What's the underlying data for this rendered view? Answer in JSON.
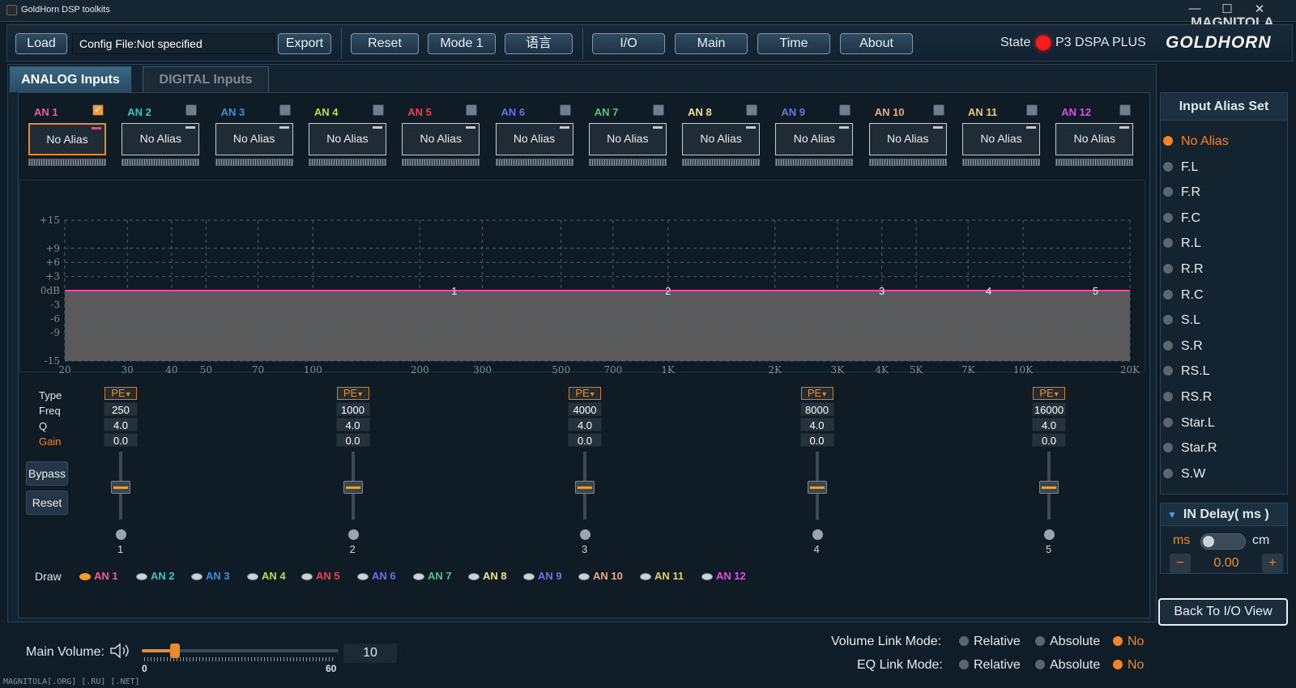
{
  "window": {
    "title": "GoldHorn DSP toolkits",
    "watermark": "MAGNITOLA",
    "footer_watermark": "MAGNITOLA[.ORG] [.RU] [.NET]"
  },
  "toolbar": {
    "load": "Load",
    "config_file": "Config File:Not specified",
    "export": "Export",
    "reset": "Reset",
    "mode": "Mode 1",
    "language": "语言",
    "io": "I/O",
    "main": "Main",
    "time": "Time",
    "about": "About",
    "state_label": "State",
    "state_color": "#ff1a1a",
    "device": "P3 DSPA PLUS",
    "brand": "GOLDHORN"
  },
  "tabs": [
    {
      "label": "ANALOG Inputs",
      "active": true
    },
    {
      "label": "DIGITAL Inputs",
      "active": false
    }
  ],
  "channels": [
    {
      "label": "AN 1",
      "color": "#f05a9c",
      "checked": true,
      "alias": "No Alias"
    },
    {
      "label": "AN 2",
      "color": "#39c7c9",
      "checked": false,
      "alias": "No Alias"
    },
    {
      "label": "AN 3",
      "color": "#3d8ee0",
      "checked": false,
      "alias": "No Alias"
    },
    {
      "label": "AN 4",
      "color": "#b7df4c",
      "checked": false,
      "alias": "No Alias"
    },
    {
      "label": "AN 5",
      "color": "#ef3f58",
      "checked": false,
      "alias": "No Alias"
    },
    {
      "label": "AN 6",
      "color": "#6a6cf2",
      "checked": false,
      "alias": "No Alias"
    },
    {
      "label": "AN 7",
      "color": "#52c67a",
      "checked": false,
      "alias": "No Alias"
    },
    {
      "label": "AN 8",
      "color": "#f2e38a",
      "checked": false,
      "alias": "No Alias"
    },
    {
      "label": "AN 9",
      "color": "#6b73e8",
      "checked": false,
      "alias": "No Alias"
    },
    {
      "label": "AN 10",
      "color": "#eea684",
      "checked": false,
      "alias": "No Alias"
    },
    {
      "label": "AN 11",
      "color": "#e6cc6a",
      "checked": false,
      "alias": "No Alias"
    },
    {
      "label": "AN 12",
      "color": "#e04ce6",
      "checked": false,
      "alias": "No Alias"
    }
  ],
  "graph": {
    "y_ticks": [
      "+15",
      "+9",
      "+6",
      "+3",
      "0dB",
      "-3",
      "-6",
      "-9",
      "-15"
    ],
    "x_ticks": [
      "20",
      "30",
      "40",
      "50",
      "70",
      "100",
      "200",
      "300",
      "500",
      "700",
      "1K",
      "2K",
      "3K",
      "4K",
      "5K",
      "7K",
      "10K",
      "20K"
    ],
    "band_markers": [
      "1",
      "2",
      "3",
      "4",
      "5"
    ],
    "curve_color": "#ff4aa0"
  },
  "eq": {
    "row_labels": {
      "type": "Type",
      "freq": "Freq",
      "q": "Q",
      "gain": "Gain"
    },
    "bypass": "Bypass",
    "reset": "Reset",
    "bands": [
      {
        "type": "PE",
        "freq": "250",
        "q": "4.0",
        "gain": "0.0",
        "num": "1"
      },
      {
        "type": "PE",
        "freq": "1000",
        "q": "4.0",
        "gain": "0.0",
        "num": "2"
      },
      {
        "type": "PE",
        "freq": "4000",
        "q": "4.0",
        "gain": "0.0",
        "num": "3"
      },
      {
        "type": "PE",
        "freq": "8000",
        "q": "4.0",
        "gain": "0.0",
        "num": "4"
      },
      {
        "type": "PE",
        "freq": "16000",
        "q": "4.0",
        "gain": "0.0",
        "num": "5"
      }
    ],
    "draw_label": "Draw"
  },
  "alias_panel": {
    "title": "Input Alias Set",
    "items": [
      "No Alias",
      "F.L",
      "F.R",
      "F.C",
      "R.L",
      "R.R",
      "R.C",
      "S.L",
      "S.R",
      "RS.L",
      "RS.R",
      "Star.L",
      "Star.R",
      "S.W"
    ],
    "selected": 0
  },
  "delay": {
    "title": "IN Delay( ms )",
    "unit_ms": "ms",
    "unit_cm": "cm",
    "value": "0.00",
    "minus": "−",
    "plus": "+"
  },
  "back_button": "Back To I/O View",
  "volume": {
    "label": "Main Volume:",
    "min": "0",
    "max": "60",
    "value": "10",
    "level_fraction": 0.167
  },
  "link_modes": [
    {
      "label": "Volume Link Mode:",
      "options": [
        "Relative",
        "Absolute",
        "No"
      ],
      "selected": 2
    },
    {
      "label": "EQ Link Mode:",
      "options": [
        "Relative",
        "Absolute",
        "No"
      ],
      "selected": 2
    }
  ]
}
